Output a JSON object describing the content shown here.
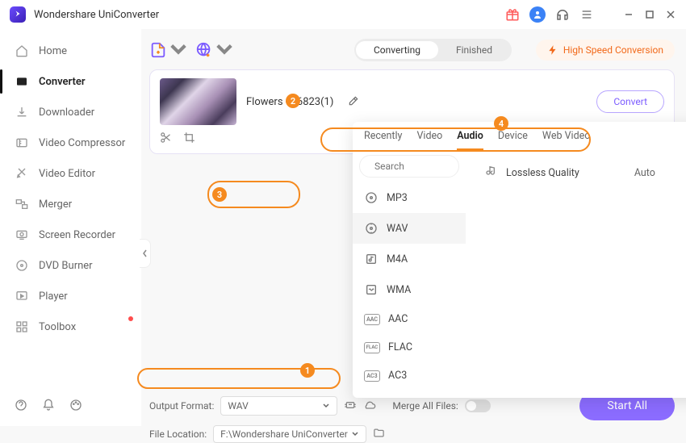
{
  "app": {
    "title": "Wondershare UniConverter"
  },
  "titlebar_icons": {
    "gift": "gift-icon",
    "avatar": "avatar-icon",
    "headset": "headset-icon",
    "menu": "menu-icon"
  },
  "sidebar": {
    "items": [
      {
        "label": "Home",
        "icon": "home-icon"
      },
      {
        "label": "Converter",
        "icon": "converter-icon"
      },
      {
        "label": "Downloader",
        "icon": "downloader-icon"
      },
      {
        "label": "Video Compressor",
        "icon": "compress-icon"
      },
      {
        "label": "Video Editor",
        "icon": "editor-icon"
      },
      {
        "label": "Merger",
        "icon": "merger-icon"
      },
      {
        "label": "Screen Recorder",
        "icon": "recorder-icon"
      },
      {
        "label": "DVD Burner",
        "icon": "dvd-icon"
      },
      {
        "label": "Player",
        "icon": "player-icon"
      },
      {
        "label": "Toolbox",
        "icon": "toolbox-icon"
      }
    ]
  },
  "toolbar": {
    "converting": "Converting",
    "finished": "Finished",
    "high_speed": "High Speed Conversion"
  },
  "file": {
    "title": "Flowers - 66823(1)",
    "convert_btn": "Convert"
  },
  "popup": {
    "tabs": [
      "Recently",
      "Video",
      "Audio",
      "Device",
      "Web Video"
    ],
    "active_tab": "Audio",
    "search_placeholder": "Search",
    "formats": [
      "MP3",
      "WAV",
      "M4A",
      "WMA",
      "AAC",
      "FLAC",
      "AC3"
    ],
    "selected_format": "WAV",
    "quality_label": "Lossless Quality",
    "quality_auto": "Auto"
  },
  "bottom": {
    "output_format_label": "Output Format:",
    "output_format_value": "WAV",
    "merge_label": "Merge All Files:",
    "file_location_label": "File Location:",
    "file_location_value": "F:\\Wondershare UniConverter",
    "start_all": "Start All"
  },
  "badges": {
    "b1": "1",
    "b2": "2",
    "b3": "3",
    "b4": "4"
  },
  "colors": {
    "accent": "#8b6cff",
    "highlight": "#f58a1f"
  }
}
